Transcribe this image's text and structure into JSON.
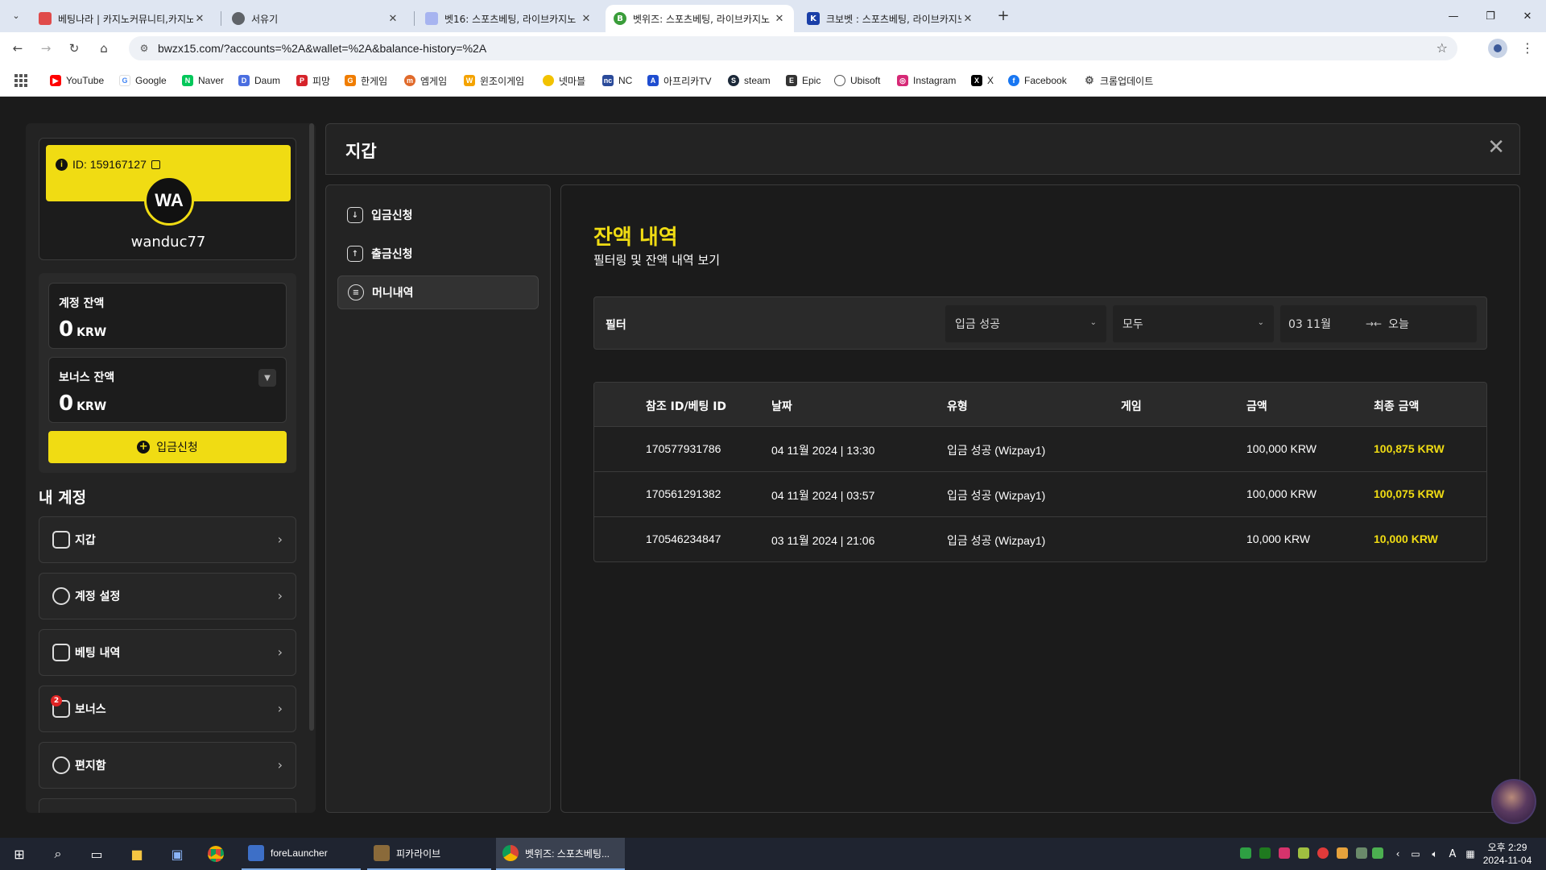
{
  "browser": {
    "tabs": [
      {
        "title": "베팅나라 | 카지노커뮤니티,카지노",
        "color": "#e04b4b"
      },
      {
        "title": "서유기",
        "color": "#5f6368"
      },
      {
        "title": "벳16: 스포츠베팅, 라이브카지노",
        "color": "#a7b4f0"
      },
      {
        "title": "벳위즈: 스포츠베팅, 라이브카지노",
        "color": "#3a9d3a"
      },
      {
        "title": "크보벳 : 스포츠베팅, 라이브카지노",
        "color": "#1a3fa8"
      }
    ],
    "url": "bwzx15.com/?accounts=%2A&wallet=%2A&balance-history=%2A",
    "bookmarks": [
      {
        "label": "YouTube",
        "color": "#ff0000"
      },
      {
        "label": "Google",
        "color": "#4285f4"
      },
      {
        "label": "Naver",
        "color": "#03c75a"
      },
      {
        "label": "Daum",
        "color": "#4a6ee0"
      },
      {
        "label": "피망",
        "color": "#d6232a"
      },
      {
        "label": "한게임",
        "color": "#f07d00"
      },
      {
        "label": "엠게임",
        "color": "#e06a2b"
      },
      {
        "label": "윈조이게임",
        "color": "#f4a300"
      },
      {
        "label": "넷마블",
        "color": "#f2c200"
      },
      {
        "label": "NC",
        "color": "#2a4a9a"
      },
      {
        "label": "아프리카TV",
        "color": "#1f4dd0"
      },
      {
        "label": "steam",
        "color": "#1b2838"
      },
      {
        "label": "Epic",
        "color": "#333333"
      },
      {
        "label": "Ubisoft",
        "color": "#555555"
      },
      {
        "label": "Instagram",
        "color": "#d62976"
      },
      {
        "label": "X",
        "color": "#000000"
      },
      {
        "label": "Facebook",
        "color": "#1877f2"
      },
      {
        "label": "크롬업데이트",
        "color": "#555555"
      }
    ]
  },
  "sidebar": {
    "user_id": "ID: 159167127",
    "avatar_initials": "WA",
    "username": "wanduc77",
    "account_balance_label": "계정 잔액",
    "account_balance_value": "0",
    "bonus_balance_label": "보너스 잔액",
    "bonus_balance_value": "0",
    "currency": "KRW",
    "deposit_button": "입금신청",
    "my_account_title": "내 계정",
    "menu": [
      {
        "label": "지갑",
        "icon": "wallet-icon"
      },
      {
        "label": "계정 설정",
        "icon": "user-icon"
      },
      {
        "label": "베팅 내역",
        "icon": "receipt-icon"
      },
      {
        "label": "보너스",
        "icon": "gift-icon",
        "badge": "2"
      },
      {
        "label": "편지함",
        "icon": "message-icon"
      }
    ]
  },
  "wallet": {
    "title": "지갑",
    "nav": [
      {
        "label": "입금신청",
        "icon": "download-icon"
      },
      {
        "label": "출금신청",
        "icon": "upload-icon"
      },
      {
        "label": "머니내역",
        "icon": "history-icon"
      }
    ],
    "content_title": "잔액 내역",
    "content_subtitle": "필터링 및 잔액 내역 보기",
    "filter": {
      "label": "필터",
      "type_value": "입금 성공",
      "scope_value": "모두",
      "date_from": "03 11월",
      "date_to": "오늘"
    },
    "table": {
      "headers": [
        "참조 ID/베팅 ID",
        "날짜",
        "유형",
        "게임",
        "금액",
        "최종 금액"
      ],
      "rows": [
        [
          "170577931786",
          "04 11월 2024 | 13:30",
          "입금 성공 (Wizpay1)",
          "",
          "100,000 KRW",
          "100,875 KRW"
        ],
        [
          "170561291382",
          "04 11월 2024 | 03:57",
          "입금 성공 (Wizpay1)",
          "",
          "100,000 KRW",
          "100,075 KRW"
        ],
        [
          "170546234847",
          "03 11월 2024 | 21:06",
          "입금 성공 (Wizpay1)",
          "",
          "10,000 KRW",
          "10,000 KRW"
        ]
      ]
    }
  },
  "taskbar": {
    "apps": [
      "foreLauncher",
      "피카라이브",
      "벳위즈: 스포츠베팅..."
    ],
    "clock_time": "오후 2:29",
    "clock_date": "2024-11-04"
  },
  "colors": {
    "accent": "#f0dc13",
    "background": "#1b1b1b",
    "panel": "#232323"
  }
}
